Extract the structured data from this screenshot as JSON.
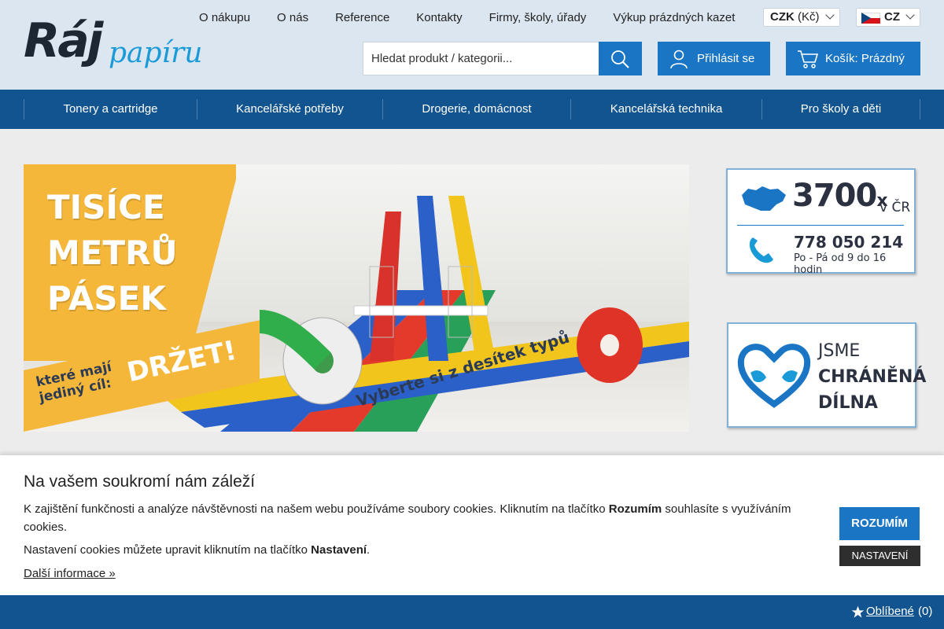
{
  "brand": {
    "logo_main": "Ráj",
    "logo_sub": "papíru"
  },
  "topnav": [
    "O nákupu",
    "O nás",
    "Reference",
    "Kontakty",
    "Firmy, školy, úřady",
    "Výkup prázdných kazet"
  ],
  "currency": {
    "code": "CZK",
    "symbol": "(Kč)"
  },
  "language": {
    "code": "CZ",
    "flag": "czech-flag"
  },
  "search": {
    "placeholder": "Hledat produkt / kategorii..."
  },
  "account": {
    "login_label": "Přihlásit se",
    "cart_label": "Košík: Prázdný"
  },
  "categories": [
    "Tonery a cartridge",
    "Kancelářské potřeby",
    "Drogerie, domácnost",
    "Kancelářská technika",
    "Pro školy a děti"
  ],
  "banner": {
    "headline": [
      "TISÍCE",
      "METRŮ",
      "PÁSEK"
    ],
    "sub_line1": "které mají",
    "sub_line2": "jediný cíl:",
    "big_word": "DRŽET!",
    "tagline": "Vyberte si z desítek typů"
  },
  "promo_contact": {
    "count": "3700",
    "count_suffix": "x",
    "country": "v ČR",
    "phone": "778 050 214",
    "hours": "Po - Pá od 9 do 16 hodin"
  },
  "promo_workshop": {
    "line1": "JSME",
    "line2": "CHRÁNĚNÁ",
    "line3": "DÍLNA"
  },
  "cookie": {
    "title": "Na vašem soukromí nám záleží",
    "p1_before": "K zajištění funkčnosti a analýze návštěvnosti na našem webu používáme soubory cookies. Kliknutím na tlačítko ",
    "p1_bold": "Rozumím",
    "p1_after": " souhlasíte s využíváním cookies.",
    "p2_before": "Nastavení cookies můžete upravit kliknutím na tlačítko ",
    "p2_bold": "Nastavení",
    "p2_after": ".",
    "more_link": "Další informace »",
    "accept_label": "ROZUMÍM",
    "settings_label": "NASTAVENÍ"
  },
  "favorites": {
    "label": "Oblíbené",
    "count": "(0)"
  },
  "colors": {
    "primary": "#1a75c4",
    "nav": "#12548f",
    "header": "#dbe6f0",
    "accent": "#1a9bd7",
    "banner_yellow": "#f4b73a"
  }
}
